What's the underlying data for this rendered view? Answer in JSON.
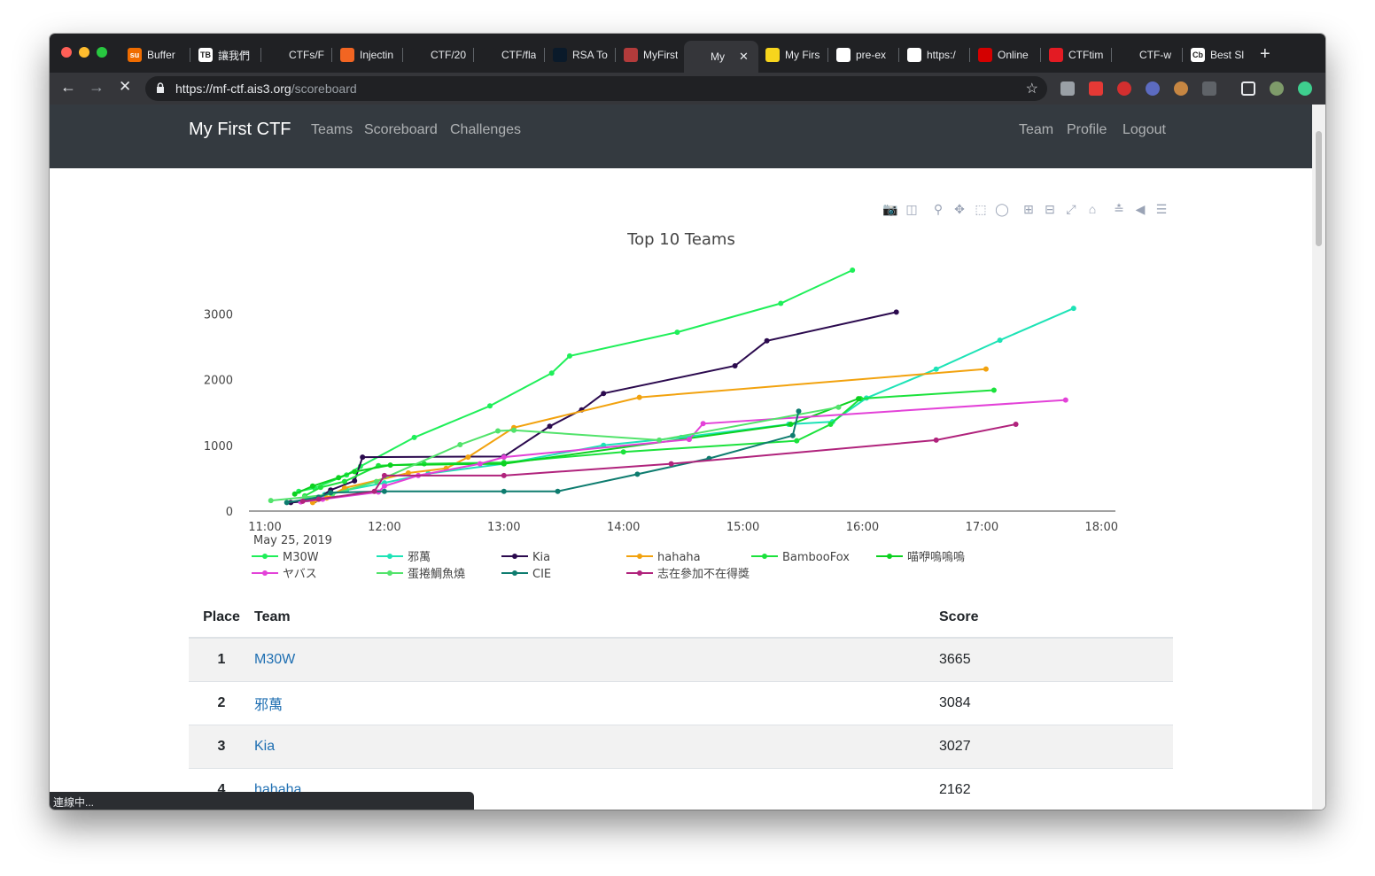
{
  "browser": {
    "tabs": [
      {
        "title": "Buffer",
        "favicon_text": "su",
        "color": "#ef6c00"
      },
      {
        "title": "讓我們",
        "favicon_text": "TB",
        "color": "#ffffff"
      },
      {
        "title": "CTFs/F",
        "favicon_text": "",
        "color": "#202124"
      },
      {
        "title": "Injectin",
        "favicon_text": "",
        "color": "#f26522"
      },
      {
        "title": "CTF/20",
        "favicon_text": "",
        "color": "#202124"
      },
      {
        "title": "CTF/fla",
        "favicon_text": "",
        "color": "#202124"
      },
      {
        "title": "RSA To",
        "favicon_text": "",
        "color": "#0a1a2a"
      },
      {
        "title": "MyFirst",
        "favicon_text": "",
        "color": "#b33b3b"
      },
      {
        "title": "My",
        "favicon_text": "",
        "color": "#35363a",
        "active": true
      },
      {
        "title": "My Firs",
        "favicon_text": "",
        "color": "#f7d51d"
      },
      {
        "title": "pre-ex",
        "favicon_text": "",
        "color": "#ffffff"
      },
      {
        "title": "https:/",
        "favicon_text": "",
        "color": "#ffffff"
      },
      {
        "title": "Online",
        "favicon_text": "",
        "color": "#d40000"
      },
      {
        "title": "CTFtim",
        "favicon_text": "",
        "color": "#e31b23"
      },
      {
        "title": "CTF-w",
        "favicon_text": "",
        "color": "#202124"
      },
      {
        "title": "Best Sl",
        "favicon_text": "Cb",
        "color": "#ffffff"
      }
    ],
    "url_host": "https://mf-ctf.ais3.org",
    "url_path": "/scoreboard",
    "status_text": "連線中..."
  },
  "navbar": {
    "brand": "My First CTF",
    "left_links": [
      "Teams",
      "Scoreboard",
      "Challenges"
    ],
    "right_links": [
      "Team",
      "Profile",
      "Logout"
    ]
  },
  "chart_data": {
    "type": "line",
    "title": "Top 10 Teams",
    "x_ticks": [
      "11:00",
      "12:00",
      "13:00",
      "14:00",
      "15:00",
      "16:00",
      "17:00",
      "18:00"
    ],
    "x_date_label": "May 25, 2019",
    "x_range": [
      "10:52",
      "18:07"
    ],
    "y_ticks": [
      0,
      1000,
      2000,
      3000
    ],
    "y_range": [
      0,
      3800
    ],
    "grid": false,
    "legend_position": "bottom",
    "series": [
      {
        "name": "M30W",
        "color": "#1fef59",
        "points": [
          [
            "11:17",
            300
          ],
          [
            "11:25",
            350
          ],
          [
            "11:41",
            550
          ],
          [
            "11:48",
            680
          ],
          [
            "12:15",
            1120
          ],
          [
            "12:53",
            1600
          ],
          [
            "13:24",
            2100
          ],
          [
            "13:33",
            2360
          ],
          [
            "14:27",
            2720
          ],
          [
            "15:19",
            3160
          ],
          [
            "15:55",
            3665
          ]
        ]
      },
      {
        "name": "邪萬",
        "color": "#1de3b6",
        "points": [
          [
            "11:22",
            180
          ],
          [
            "11:30",
            250
          ],
          [
            "11:41",
            320
          ],
          [
            "12:00",
            430
          ],
          [
            "12:22",
            570
          ],
          [
            "13:00",
            720
          ],
          [
            "13:50",
            1000
          ],
          [
            "14:29",
            1120
          ],
          [
            "15:23",
            1320
          ],
          [
            "15:45",
            1360
          ],
          [
            "16:02",
            1720
          ],
          [
            "16:37",
            2160
          ],
          [
            "17:09",
            2600
          ],
          [
            "17:46",
            3084
          ]
        ]
      },
      {
        "name": "Kia",
        "color": "#2b0a4e",
        "points": [
          [
            "11:13",
            130
          ],
          [
            "11:25",
            160
          ],
          [
            "11:33",
            320
          ],
          [
            "11:45",
            460
          ],
          [
            "11:49",
            820
          ],
          [
            "13:00",
            830
          ],
          [
            "13:23",
            1290
          ],
          [
            "13:39",
            1540
          ],
          [
            "13:50",
            1790
          ],
          [
            "14:56",
            2210
          ],
          [
            "15:12",
            2590
          ],
          [
            "16:17",
            3027
          ]
        ]
      },
      {
        "name": "hahaha",
        "color": "#f2a20e",
        "points": [
          [
            "11:24",
            130
          ],
          [
            "11:31",
            200
          ],
          [
            "11:40",
            350
          ],
          [
            "12:12",
            580
          ],
          [
            "12:31",
            650
          ],
          [
            "12:42",
            820
          ],
          [
            "13:05",
            1270
          ],
          [
            "14:08",
            1730
          ],
          [
            "17:02",
            2162
          ]
        ]
      },
      {
        "name": "BambooFox",
        "color": "#1be23c",
        "points": [
          [
            "11:20",
            230
          ],
          [
            "11:28",
            360
          ],
          [
            "11:40",
            450
          ],
          [
            "11:57",
            690
          ],
          [
            "12:20",
            720
          ],
          [
            "13:00",
            740
          ],
          [
            "14:00",
            900
          ],
          [
            "15:27",
            1070
          ],
          [
            "15:44",
            1320
          ],
          [
            "15:59",
            1710
          ],
          [
            "17:06",
            1840
          ]
        ]
      },
      {
        "name": "喵咿嗚嗚嗚",
        "color": "#0cd120",
        "points": [
          [
            "11:15",
            260
          ],
          [
            "11:24",
            380
          ],
          [
            "11:37",
            510
          ],
          [
            "11:45",
            600
          ],
          [
            "12:03",
            700
          ],
          [
            "13:00",
            720
          ],
          [
            "15:24",
            1320
          ],
          [
            "15:58",
            1710
          ]
        ]
      },
      {
        "name": "ヤバス",
        "color": "#e342d8",
        "points": [
          [
            "11:18",
            140
          ],
          [
            "11:29",
            180
          ],
          [
            "11:57",
            290
          ],
          [
            "12:00",
            380
          ],
          [
            "12:17",
            540
          ],
          [
            "12:48",
            720
          ],
          [
            "13:00",
            820
          ],
          [
            "14:33",
            1090
          ],
          [
            "14:40",
            1330
          ],
          [
            "17:42",
            1690
          ]
        ]
      },
      {
        "name": "蛋捲鯛魚燒",
        "color": "#52e36b",
        "points": [
          [
            "11:03",
            160
          ],
          [
            "11:20",
            210
          ],
          [
            "11:34",
            260
          ],
          [
            "11:56",
            450
          ],
          [
            "12:38",
            1010
          ],
          [
            "12:57",
            1220
          ],
          [
            "13:05",
            1230
          ],
          [
            "14:18",
            1080
          ],
          [
            "15:48",
            1580
          ]
        ]
      },
      {
        "name": "CIE",
        "color": "#0e7c6f",
        "points": [
          [
            "11:11",
            130
          ],
          [
            "11:27",
            210
          ],
          [
            "11:33",
            280
          ],
          [
            "12:00",
            300
          ],
          [
            "13:00",
            300
          ],
          [
            "13:27",
            300
          ],
          [
            "14:07",
            560
          ],
          [
            "14:43",
            800
          ],
          [
            "15:25",
            1150
          ],
          [
            "15:28",
            1520
          ]
        ]
      },
      {
        "name": "志在參加不在得獎",
        "color": "#b0237c",
        "points": [
          [
            "11:19",
            150
          ],
          [
            "11:27",
            180
          ],
          [
            "11:55",
            300
          ],
          [
            "12:00",
            540
          ],
          [
            "13:00",
            540
          ],
          [
            "14:24",
            720
          ],
          [
            "16:37",
            1080
          ],
          [
            "17:17",
            1320
          ]
        ]
      }
    ]
  },
  "table": {
    "headers": {
      "place": "Place",
      "team": "Team",
      "score": "Score"
    },
    "rows": [
      {
        "place": "1",
        "team": "M30W",
        "score": "3665"
      },
      {
        "place": "2",
        "team": "邪萬",
        "score": "3084"
      },
      {
        "place": "3",
        "team": "Kia",
        "score": "3027"
      },
      {
        "place": "4",
        "team": "hahaha",
        "score": "2162"
      }
    ]
  },
  "modebar_icons": [
    "camera-icon",
    "save-icon",
    "zoom-icon",
    "pan-icon",
    "box-select-icon",
    "lasso-icon",
    "zoom-in-icon",
    "zoom-out-icon",
    "autoscale-icon",
    "reset-axes-icon",
    "spike-lines-icon",
    "hover-closest-icon",
    "hover-compare-icon"
  ]
}
